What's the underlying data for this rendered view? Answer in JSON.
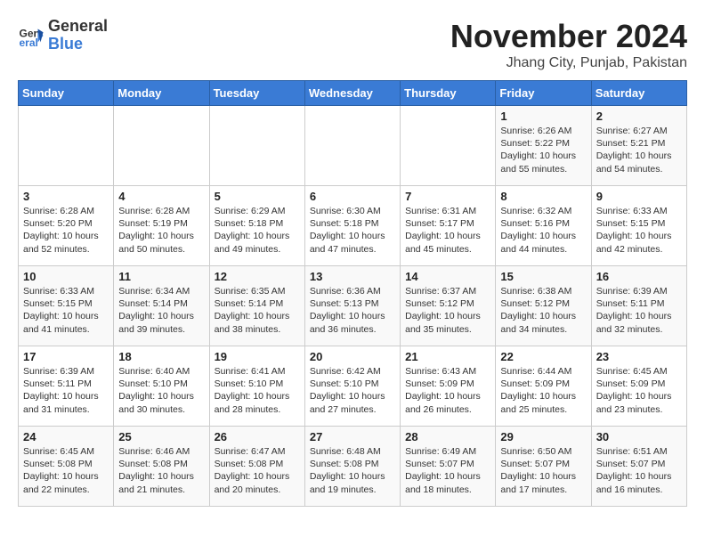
{
  "logo": {
    "general": "General",
    "blue": "Blue"
  },
  "title": "November 2024",
  "subtitle": "Jhang City, Punjab, Pakistan",
  "weekdays": [
    "Sunday",
    "Monday",
    "Tuesday",
    "Wednesday",
    "Thursday",
    "Friday",
    "Saturday"
  ],
  "weeks": [
    [
      {
        "day": "",
        "info": ""
      },
      {
        "day": "",
        "info": ""
      },
      {
        "day": "",
        "info": ""
      },
      {
        "day": "",
        "info": ""
      },
      {
        "day": "",
        "info": ""
      },
      {
        "day": "1",
        "info": "Sunrise: 6:26 AM\nSunset: 5:22 PM\nDaylight: 10 hours and 55 minutes."
      },
      {
        "day": "2",
        "info": "Sunrise: 6:27 AM\nSunset: 5:21 PM\nDaylight: 10 hours and 54 minutes."
      }
    ],
    [
      {
        "day": "3",
        "info": "Sunrise: 6:28 AM\nSunset: 5:20 PM\nDaylight: 10 hours and 52 minutes."
      },
      {
        "day": "4",
        "info": "Sunrise: 6:28 AM\nSunset: 5:19 PM\nDaylight: 10 hours and 50 minutes."
      },
      {
        "day": "5",
        "info": "Sunrise: 6:29 AM\nSunset: 5:18 PM\nDaylight: 10 hours and 49 minutes."
      },
      {
        "day": "6",
        "info": "Sunrise: 6:30 AM\nSunset: 5:18 PM\nDaylight: 10 hours and 47 minutes."
      },
      {
        "day": "7",
        "info": "Sunrise: 6:31 AM\nSunset: 5:17 PM\nDaylight: 10 hours and 45 minutes."
      },
      {
        "day": "8",
        "info": "Sunrise: 6:32 AM\nSunset: 5:16 PM\nDaylight: 10 hours and 44 minutes."
      },
      {
        "day": "9",
        "info": "Sunrise: 6:33 AM\nSunset: 5:15 PM\nDaylight: 10 hours and 42 minutes."
      }
    ],
    [
      {
        "day": "10",
        "info": "Sunrise: 6:33 AM\nSunset: 5:15 PM\nDaylight: 10 hours and 41 minutes."
      },
      {
        "day": "11",
        "info": "Sunrise: 6:34 AM\nSunset: 5:14 PM\nDaylight: 10 hours and 39 minutes."
      },
      {
        "day": "12",
        "info": "Sunrise: 6:35 AM\nSunset: 5:14 PM\nDaylight: 10 hours and 38 minutes."
      },
      {
        "day": "13",
        "info": "Sunrise: 6:36 AM\nSunset: 5:13 PM\nDaylight: 10 hours and 36 minutes."
      },
      {
        "day": "14",
        "info": "Sunrise: 6:37 AM\nSunset: 5:12 PM\nDaylight: 10 hours and 35 minutes."
      },
      {
        "day": "15",
        "info": "Sunrise: 6:38 AM\nSunset: 5:12 PM\nDaylight: 10 hours and 34 minutes."
      },
      {
        "day": "16",
        "info": "Sunrise: 6:39 AM\nSunset: 5:11 PM\nDaylight: 10 hours and 32 minutes."
      }
    ],
    [
      {
        "day": "17",
        "info": "Sunrise: 6:39 AM\nSunset: 5:11 PM\nDaylight: 10 hours and 31 minutes."
      },
      {
        "day": "18",
        "info": "Sunrise: 6:40 AM\nSunset: 5:10 PM\nDaylight: 10 hours and 30 minutes."
      },
      {
        "day": "19",
        "info": "Sunrise: 6:41 AM\nSunset: 5:10 PM\nDaylight: 10 hours and 28 minutes."
      },
      {
        "day": "20",
        "info": "Sunrise: 6:42 AM\nSunset: 5:10 PM\nDaylight: 10 hours and 27 minutes."
      },
      {
        "day": "21",
        "info": "Sunrise: 6:43 AM\nSunset: 5:09 PM\nDaylight: 10 hours and 26 minutes."
      },
      {
        "day": "22",
        "info": "Sunrise: 6:44 AM\nSunset: 5:09 PM\nDaylight: 10 hours and 25 minutes."
      },
      {
        "day": "23",
        "info": "Sunrise: 6:45 AM\nSunset: 5:09 PM\nDaylight: 10 hours and 23 minutes."
      }
    ],
    [
      {
        "day": "24",
        "info": "Sunrise: 6:45 AM\nSunset: 5:08 PM\nDaylight: 10 hours and 22 minutes."
      },
      {
        "day": "25",
        "info": "Sunrise: 6:46 AM\nSunset: 5:08 PM\nDaylight: 10 hours and 21 minutes."
      },
      {
        "day": "26",
        "info": "Sunrise: 6:47 AM\nSunset: 5:08 PM\nDaylight: 10 hours and 20 minutes."
      },
      {
        "day": "27",
        "info": "Sunrise: 6:48 AM\nSunset: 5:08 PM\nDaylight: 10 hours and 19 minutes."
      },
      {
        "day": "28",
        "info": "Sunrise: 6:49 AM\nSunset: 5:07 PM\nDaylight: 10 hours and 18 minutes."
      },
      {
        "day": "29",
        "info": "Sunrise: 6:50 AM\nSunset: 5:07 PM\nDaylight: 10 hours and 17 minutes."
      },
      {
        "day": "30",
        "info": "Sunrise: 6:51 AM\nSunset: 5:07 PM\nDaylight: 10 hours and 16 minutes."
      }
    ]
  ]
}
